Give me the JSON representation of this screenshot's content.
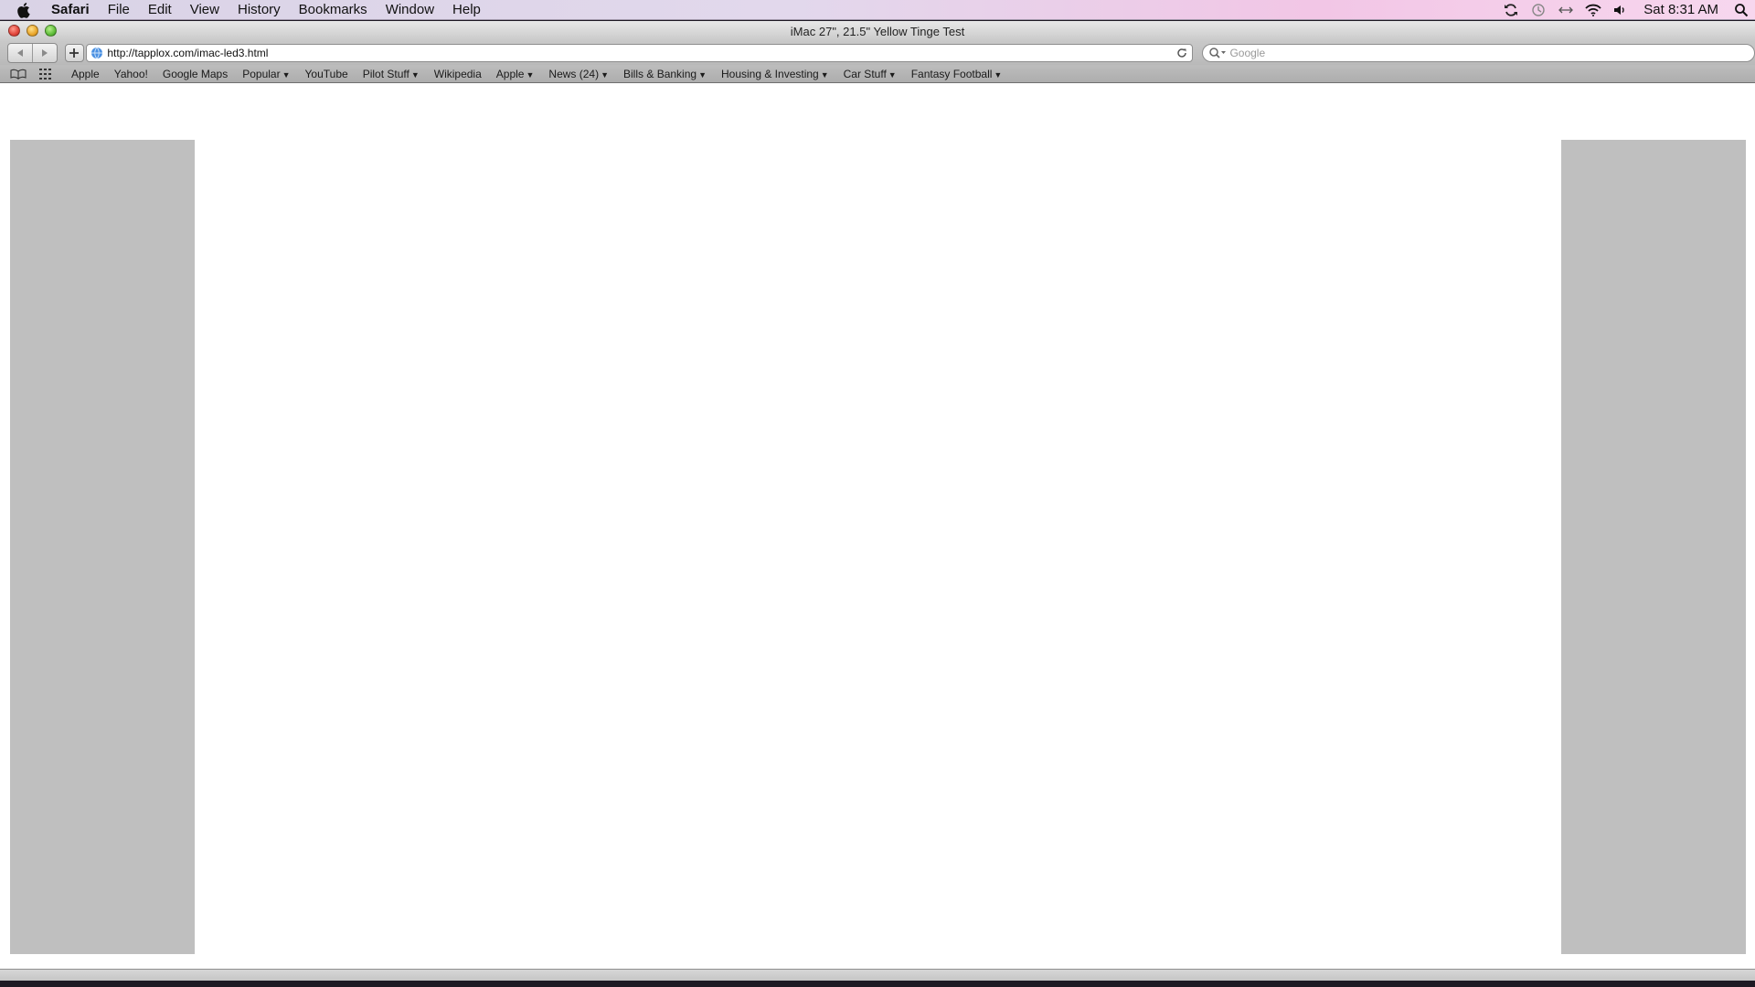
{
  "menubar": {
    "apple_icon": "apple-logo-icon",
    "app_name": "Safari",
    "items": [
      "File",
      "Edit",
      "View",
      "History",
      "Bookmarks",
      "Window",
      "Help"
    ],
    "status_icons": [
      "sync-icon",
      "time-machine-icon",
      "network-arrows-icon",
      "wifi-icon",
      "volume-icon"
    ],
    "clock": "Sat 8:31 AM",
    "spotlight_icon": "spotlight-search-icon"
  },
  "window": {
    "title": "iMac 27\", 21.5\" Yellow Tinge Test",
    "address": "http://tapplox.com/imac-led3.html",
    "search_placeholder": "Google",
    "bookmarks": [
      {
        "label": "Apple",
        "menu": false
      },
      {
        "label": "Yahoo!",
        "menu": false
      },
      {
        "label": "Google Maps",
        "menu": false
      },
      {
        "label": "Popular",
        "menu": true
      },
      {
        "label": "YouTube",
        "menu": false
      },
      {
        "label": "Pilot Stuff",
        "menu": true
      },
      {
        "label": "Wikipedia",
        "menu": false
      },
      {
        "label": "Apple",
        "menu": true
      },
      {
        "label": "News (24)",
        "menu": true
      },
      {
        "label": "Bills & Banking",
        "menu": true
      },
      {
        "label": "Housing & Investing",
        "menu": true
      },
      {
        "label": "Car Stuff",
        "menu": true
      },
      {
        "label": "Fantasy Football",
        "menu": true
      }
    ]
  },
  "colors": {
    "side_panels": "#bfbfbf",
    "page_background": "#ffffff"
  }
}
